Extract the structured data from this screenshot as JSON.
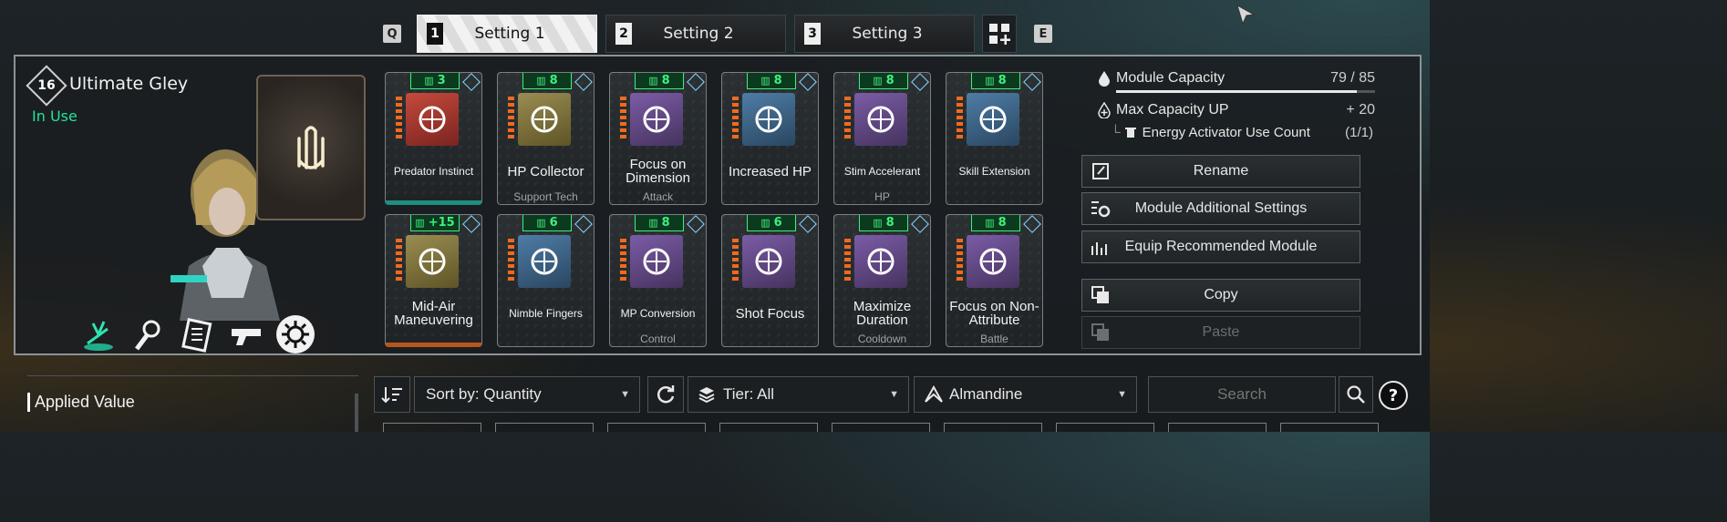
{
  "tabs": {
    "prev_key": "Q",
    "next_key": "E",
    "items": [
      {
        "num": "1",
        "label": "Setting 1"
      },
      {
        "num": "2",
        "label": "Setting 2"
      },
      {
        "num": "3",
        "label": "Setting 3"
      }
    ],
    "active": 0
  },
  "character": {
    "level": "16",
    "name": "Ultimate Gley",
    "status": "In Use",
    "skills": [
      "predator-skill-icon",
      "hand-spark-skill-icon",
      "bullet-skill-icon",
      "gun-skill-icon",
      "burst-skill-icon"
    ]
  },
  "modules": [
    {
      "cost": "3",
      "name": "Predator Instinct",
      "type": "",
      "color": "red",
      "small": true,
      "selected": "teal",
      "icon": "hand-plant-icon"
    },
    {
      "cost": "8",
      "name": "HP Collector",
      "type": "Support Tech",
      "color": "gold",
      "icon": "syringe-icon"
    },
    {
      "cost": "8",
      "name": "Focus on Dimension",
      "type": "Attack",
      "color": "purple",
      "icon": "dimension-icon"
    },
    {
      "cost": "8",
      "name": "Increased HP",
      "type": "",
      "color": "blue",
      "icon": "heart-hands-icon"
    },
    {
      "cost": "8",
      "name": "Stim Accelerant",
      "type": "HP",
      "color": "purple",
      "small": true,
      "icon": "heart-icon"
    },
    {
      "cost": "8",
      "name": "Skill Extension",
      "type": "",
      "color": "blue",
      "small": true,
      "icon": "diamond-circle-icon"
    },
    {
      "cost": "+15",
      "name": "Mid-Air Maneuvering",
      "type": "",
      "color": "gold",
      "selected": "orange",
      "icon": "grapple-icon"
    },
    {
      "cost": "6",
      "name": "Nimble Fingers",
      "type": "",
      "color": "blue",
      "small": true,
      "icon": "gauge-down-icon"
    },
    {
      "cost": "8",
      "name": "MP Conversion",
      "type": "Control",
      "color": "purple",
      "small": true,
      "icon": "gauge-arrow-icon"
    },
    {
      "cost": "6",
      "name": "Shot Focus",
      "type": "",
      "color": "purple",
      "icon": "crosshair-icon"
    },
    {
      "cost": "8",
      "name": "Maximize Duration",
      "type": "Cooldown",
      "color": "purple",
      "icon": "cycle-icon"
    },
    {
      "cost": "8",
      "name": "Focus on Non-Attribute",
      "type": "Battle",
      "color": "purple",
      "icon": "dimension-icon"
    }
  ],
  "capacity": {
    "label": "Module Capacity",
    "value": "79 / 85",
    "fill": 0.93,
    "max_label": "Max Capacity UP",
    "max_value": "+ 20",
    "eac_label": "Energy Activator Use Count",
    "eac_value": "(1/1)"
  },
  "actions": {
    "rename": "Rename",
    "additional": "Module Additional Settings",
    "recommend": "Equip Recommended Module",
    "copy": "Copy",
    "paste": "Paste"
  },
  "filters": {
    "applied": "Applied Value",
    "sort": "Sort by: Quantity",
    "tier": "Tier: All",
    "socket": "Almandine",
    "search_placeholder": "Search",
    "help": "?"
  }
}
